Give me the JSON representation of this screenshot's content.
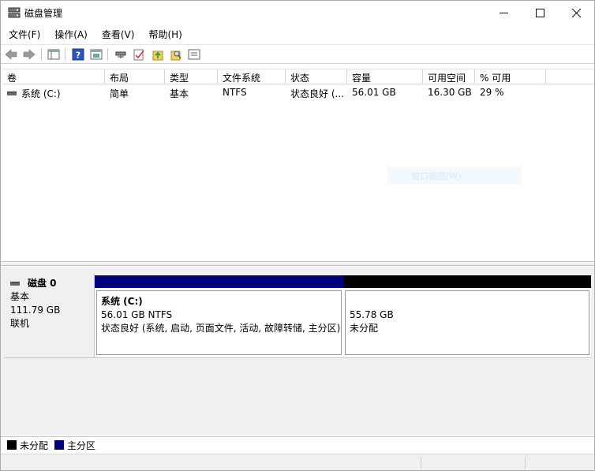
{
  "window": {
    "title": "磁盘管理",
    "controls": {
      "minimize": "—",
      "maximize": "☐",
      "close": "✕"
    }
  },
  "menu": [
    "文件(F)",
    "操作(A)",
    "查看(V)",
    "帮助(H)"
  ],
  "toolbar": {
    "icons": [
      "back-arrow-icon",
      "forward-arrow-icon",
      "console-tree-icon",
      "help-icon",
      "properties-icon",
      "connect-drive-icon",
      "checklist-icon",
      "folder-up-icon",
      "find-icon",
      "view-icon"
    ]
  },
  "volume_table": {
    "columns": [
      "卷",
      "布局",
      "类型",
      "文件系统",
      "状态",
      "容量",
      "可用空间",
      "% 可用"
    ],
    "rows": [
      [
        "系统 (C:)",
        "简单",
        "基本",
        "NTFS",
        "状态良好 (...",
        "56.01 GB",
        "16.30 GB",
        "29 %"
      ]
    ]
  },
  "watermark": "窗口截图(W)",
  "disks": [
    {
      "name": "磁盘 0",
      "type": "基本",
      "size": "111.79 GB",
      "status": "联机",
      "partitions": [
        {
          "name": "系统  (C:)",
          "size_fs": "56.01 GB NTFS",
          "status": "状态良好 (系统, 启动, 页面文件, 活动, 故障转储, 主分区)",
          "bar_color": "#00007f"
        },
        {
          "name": "",
          "size_fs": "55.78 GB",
          "status": "未分配",
          "bar_color": "#000000"
        }
      ]
    }
  ],
  "legend": [
    {
      "label": "未分配",
      "color": "#000000"
    },
    {
      "label": "主分区",
      "color": "#00007f"
    }
  ]
}
